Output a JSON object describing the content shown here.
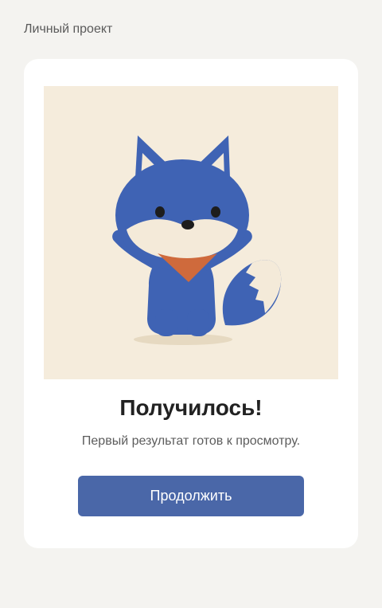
{
  "header": {
    "workspace_label": "Личный проект"
  },
  "card": {
    "illustration_icon": "fox-mascot-waving",
    "title": "Получилось!",
    "subtitle": "Первый результат готов к просмотру.",
    "continue_label": "Продолжить"
  },
  "colors": {
    "page_background": "#f4f3f0",
    "card_background": "#ffffff",
    "illustration_background": "#f5ecdc",
    "fox_blue": "#3f63b4",
    "fox_cream": "#f4ead9",
    "bandana": "#cf6a3c",
    "button": "#4a67a8",
    "button_text": "#ffffff"
  }
}
